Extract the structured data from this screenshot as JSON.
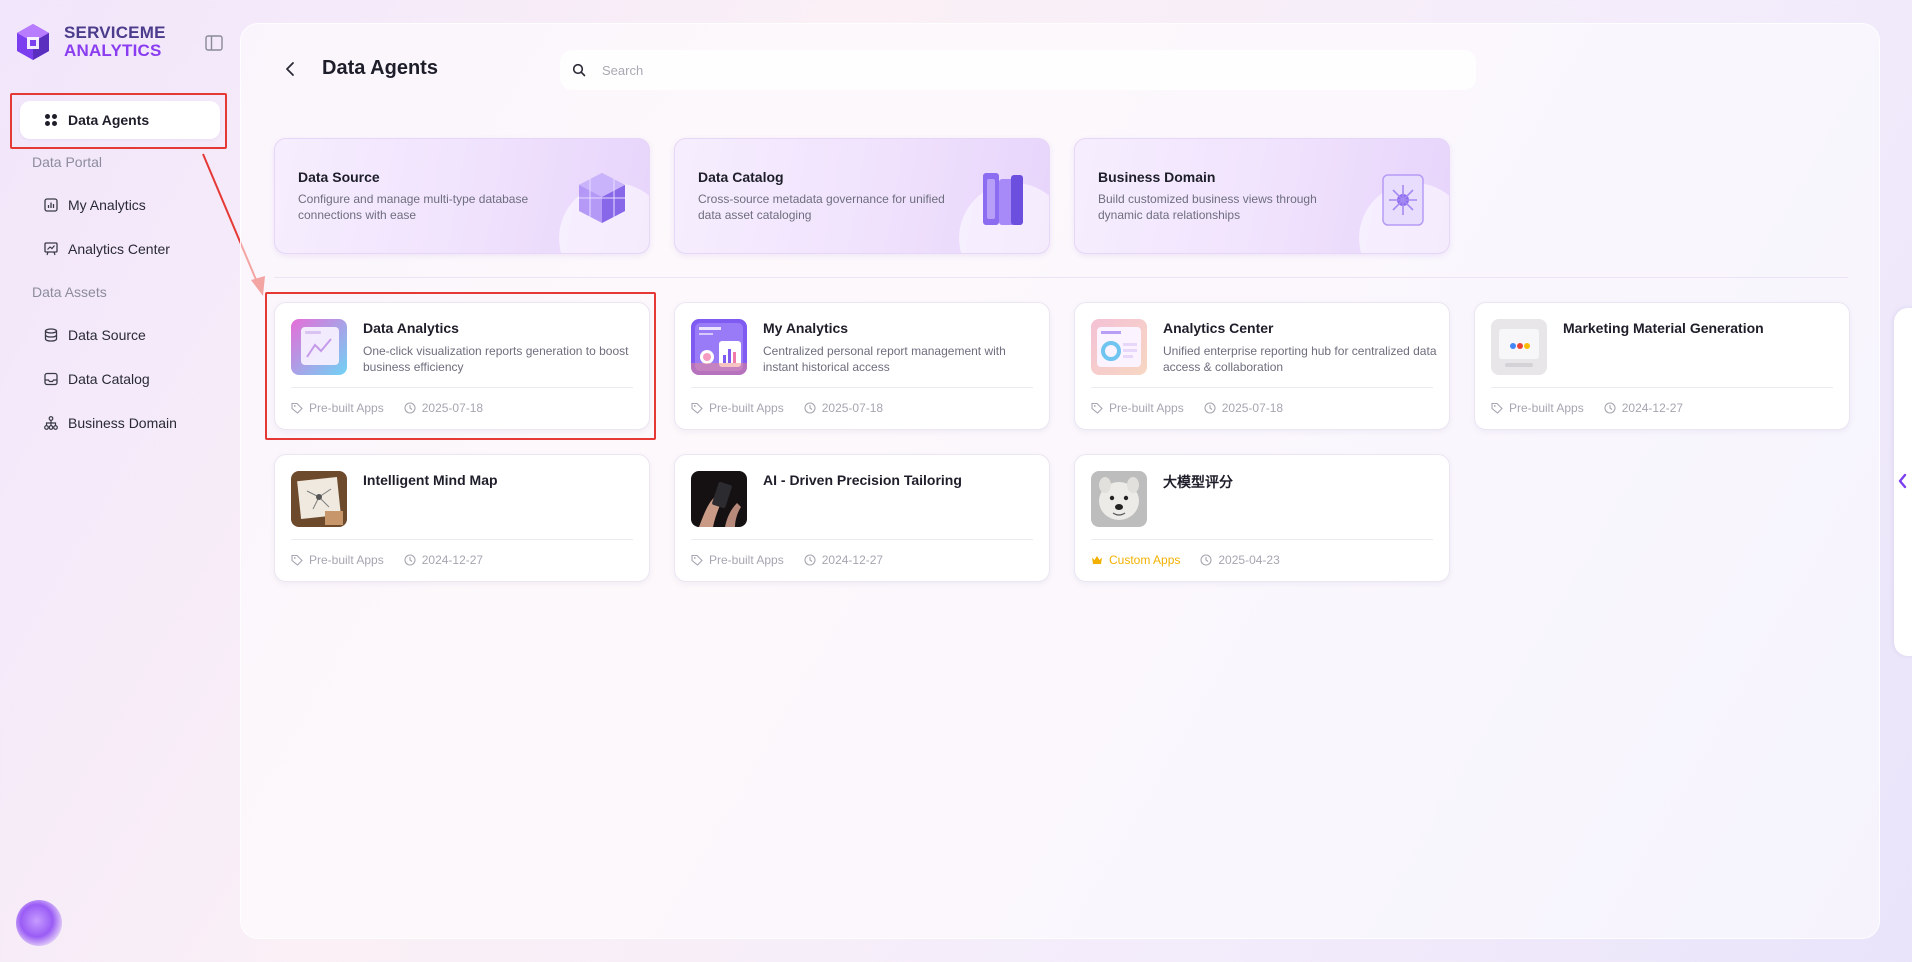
{
  "brand": {
    "line1": "SERVICEME",
    "line2": "ANALYTICS"
  },
  "sidebar": {
    "active_item": "Data Agents",
    "sections": [
      {
        "title": "Data Portal",
        "items": [
          "My Analytics",
          "Analytics Center"
        ]
      },
      {
        "title": "Data Assets",
        "items": [
          "Data Source",
          "Data Catalog",
          "Business Domain"
        ]
      }
    ]
  },
  "header": {
    "title": "Data Agents",
    "search_placeholder": "Search"
  },
  "features": [
    {
      "title": "Data Source",
      "desc": "Configure and manage multi-type database connections with ease"
    },
    {
      "title": "Data Catalog",
      "desc": "Cross-source metadata governance for unified data asset cataloging"
    },
    {
      "title": "Business Domain",
      "desc": "Build customized business views through dynamic data relationships"
    }
  ],
  "apps": [
    {
      "title": "Data Analytics",
      "desc": "One-click visualization reports generation to boost business efficiency",
      "tag": "Pre-built Apps",
      "date": "2025-07-18"
    },
    {
      "title": "My Analytics",
      "desc": "Centralized personal report management with instant historical access",
      "tag": "Pre-built Apps",
      "date": "2025-07-18"
    },
    {
      "title": "Analytics Center",
      "desc": "Unified enterprise reporting hub for centralized data access & collaboration",
      "tag": "Pre-built Apps",
      "date": "2025-07-18"
    },
    {
      "title": "Marketing Material Generation",
      "desc": "",
      "tag": "Pre-built Apps",
      "date": "2024-12-27"
    },
    {
      "title": "Intelligent Mind Map",
      "desc": "",
      "tag": "Pre-built Apps",
      "date": "2024-12-27"
    },
    {
      "title": "AI - Driven Precision Tailoring",
      "desc": "",
      "tag": "Pre-built Apps",
      "date": "2024-12-27"
    },
    {
      "title": "大模型评分",
      "desc": "",
      "tag": "Custom Apps",
      "date": "2025-04-23"
    }
  ],
  "colors": {
    "accent": "#8a3cf0",
    "highlight": "#e53935",
    "custom_tag": "#f2b100"
  }
}
